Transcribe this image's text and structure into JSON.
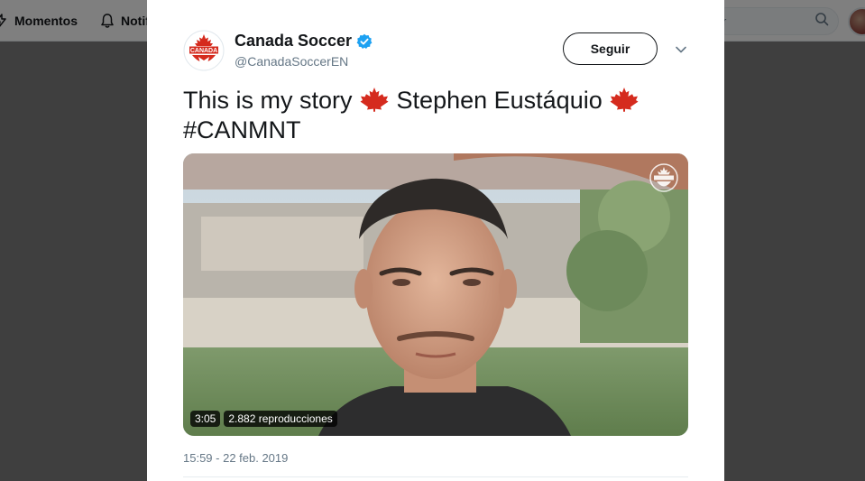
{
  "topnav": {
    "moments_label": "Momentos",
    "notifications_label": "Notif",
    "search_placeholder": "r"
  },
  "tweet": {
    "author_name": "Canada Soccer",
    "author_handle": "@CanadaSoccerEN",
    "verified": true,
    "follow_label": "Seguir",
    "text_line1": "This is my story",
    "text_name": "Stephen Eustáquio",
    "hashtag": "#CANMNT",
    "logo_text": "CANADA",
    "timestamp": "15:59 - 22 feb. 2019"
  },
  "video": {
    "duration": "3:05",
    "views": "2.882 reproducciones"
  },
  "colors": {
    "maple_red": "#d52b1e",
    "verified_blue": "#1da1f2",
    "text": "#14171a",
    "muted": "#657786"
  }
}
